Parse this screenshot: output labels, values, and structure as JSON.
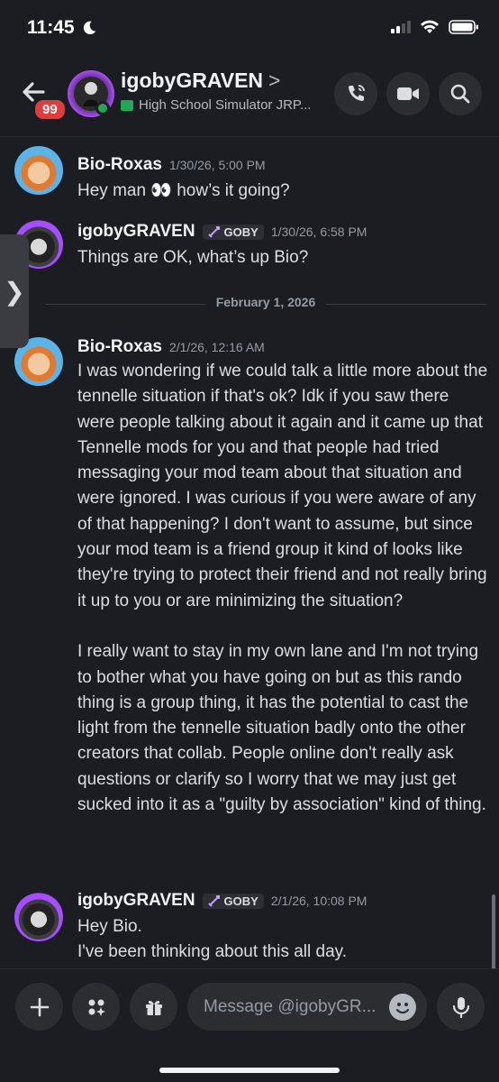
{
  "status": {
    "time": "11:45"
  },
  "header": {
    "back_badge": "99",
    "name": "igobyGRAVEN",
    "chevron": ">",
    "subtitle": "High School Simulator JRP..."
  },
  "side_tab": {
    "glyph": "❯"
  },
  "messages": [
    {
      "author": "Bio-Roxas",
      "time": "1/30/26, 5:00 PM",
      "role": null,
      "text": "Hey man 👀 how’s it going?"
    },
    {
      "author": "igobyGRAVEN",
      "time": "1/30/26, 6:58 PM",
      "role": "GOBY",
      "text": "Things are OK, what’s up Bio?"
    },
    {
      "author": "Bio-Roxas",
      "time": "2/1/26, 12:16 AM",
      "role": null,
      "text": "I was wondering if we could talk a little more about the tennelle situation if that's ok? Idk if you saw there were people talking about it again and it came up that Tennelle mods for you and that people had tried messaging your mod team about that situation and were ignored. I was curious if you were aware of any of that happening? I don't want to assume, but since your mod team is a friend group it kind of looks like they're trying to protect their friend and not really bring it up to you or are minimizing the situation?\n\nI really want to stay in my own lane and I'm not trying to bother what you have going on but as this rando thing is a group thing, it has the potential to cast the light from the tennelle situation badly onto the other creators that collab. People online don't really ask questions or clarify so I worry that we may just get sucked into it as a \"guilty by association\" kind of thing."
    },
    {
      "author": "igobyGRAVEN",
      "time": "2/1/26, 10:08 PM",
      "role": "GOBY",
      "text": "Hey Bio.\nI've been thinking about this all day."
    }
  ],
  "divider": {
    "date": "February 1, 2026"
  },
  "composer": {
    "placeholder": "Message @igobyGR..."
  },
  "colors": {
    "background": "#1c1d22",
    "online": "#23a55a",
    "badge": "#e23b3b",
    "accent_purple": "#a64dff"
  }
}
